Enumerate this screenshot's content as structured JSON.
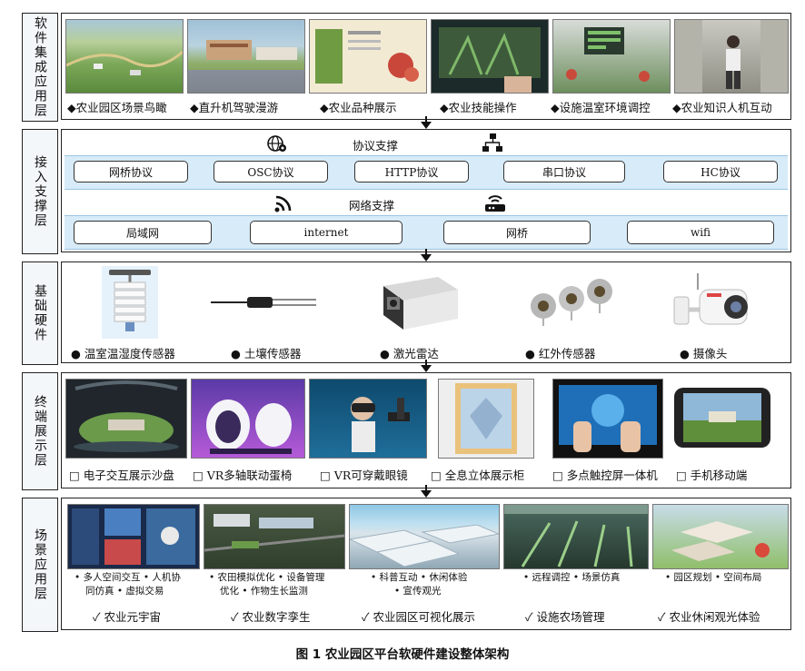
{
  "layers": {
    "software": {
      "label": "软件集成应用层",
      "items": [
        {
          "text": "农业园区场景鸟瞰",
          "bullet": "◆"
        },
        {
          "text": "直升机驾驶漫游",
          "bullet": "◆"
        },
        {
          "text": "农业品种展示",
          "bullet": "◆"
        },
        {
          "text": "农业技能操作",
          "bullet": "◆"
        },
        {
          "text": "设施温室环境调控",
          "bullet": "◆"
        },
        {
          "text": "农业知识人机互动",
          "bullet": "◆"
        }
      ]
    },
    "access": {
      "label": "接入支撑层",
      "protocol_title": "协议支撑",
      "protocols": [
        "网桥协议",
        "OSC协议",
        "HTTP协议",
        "串口协议",
        "HC协议"
      ],
      "network_title": "网络支撑",
      "networks": [
        "局域网",
        "internet",
        "网桥",
        "wifi"
      ]
    },
    "hardware": {
      "label": "基础硬件",
      "items": [
        {
          "text": "温室温湿度传感器",
          "bullet": "●"
        },
        {
          "text": "土壤传感器",
          "bullet": "●"
        },
        {
          "text": "激光雷达",
          "bullet": "●"
        },
        {
          "text": "红外传感器",
          "bullet": "●"
        },
        {
          "text": "摄像头",
          "bullet": "●"
        }
      ]
    },
    "terminal": {
      "label": "终端展示层",
      "items": [
        {
          "text": "电子交互展示沙盘",
          "bullet": "□"
        },
        {
          "text": "VR多轴联动蛋椅",
          "bullet": "□"
        },
        {
          "text": "VR可穿戴眼镜",
          "bullet": "□"
        },
        {
          "text": "全息立体展示柜",
          "bullet": "□"
        },
        {
          "text": "多点触控屏一体机",
          "bullet": "□"
        },
        {
          "text": "手机移动端",
          "bullet": "□"
        }
      ]
    },
    "scene": {
      "label": "场景应用层",
      "items": [
        {
          "bullets_line1": "• 多人空间交互 • 人机协",
          "bullets_line2": "同仿真 • 虚拟交易",
          "title": "农业元宇宙"
        },
        {
          "bullets_line1": "• 农田模拟优化 • 设备管理",
          "bullets_line2": "优化 • 作物生长监测",
          "title": "农业数字孪生"
        },
        {
          "bullets_line1": "• 科普互动 • 休闲体验",
          "bullets_line2": "• 宣传观光",
          "title": "农业园区可视化展示"
        },
        {
          "bullets_line1": "• 远程调控 • 场景仿真",
          "bullets_line2": "",
          "title": "设施农场管理"
        },
        {
          "bullets_line1": "• 园区规划 • 空间布局",
          "bullets_line2": "",
          "title": "农业休闲观光体验"
        }
      ],
      "check": "✓"
    }
  },
  "caption": "图 1   农业园区平台软硬件建设整体架构",
  "colors": {
    "band": "#d7ebf8",
    "label_bg": "#f4f7f9",
    "border": "#222222"
  }
}
